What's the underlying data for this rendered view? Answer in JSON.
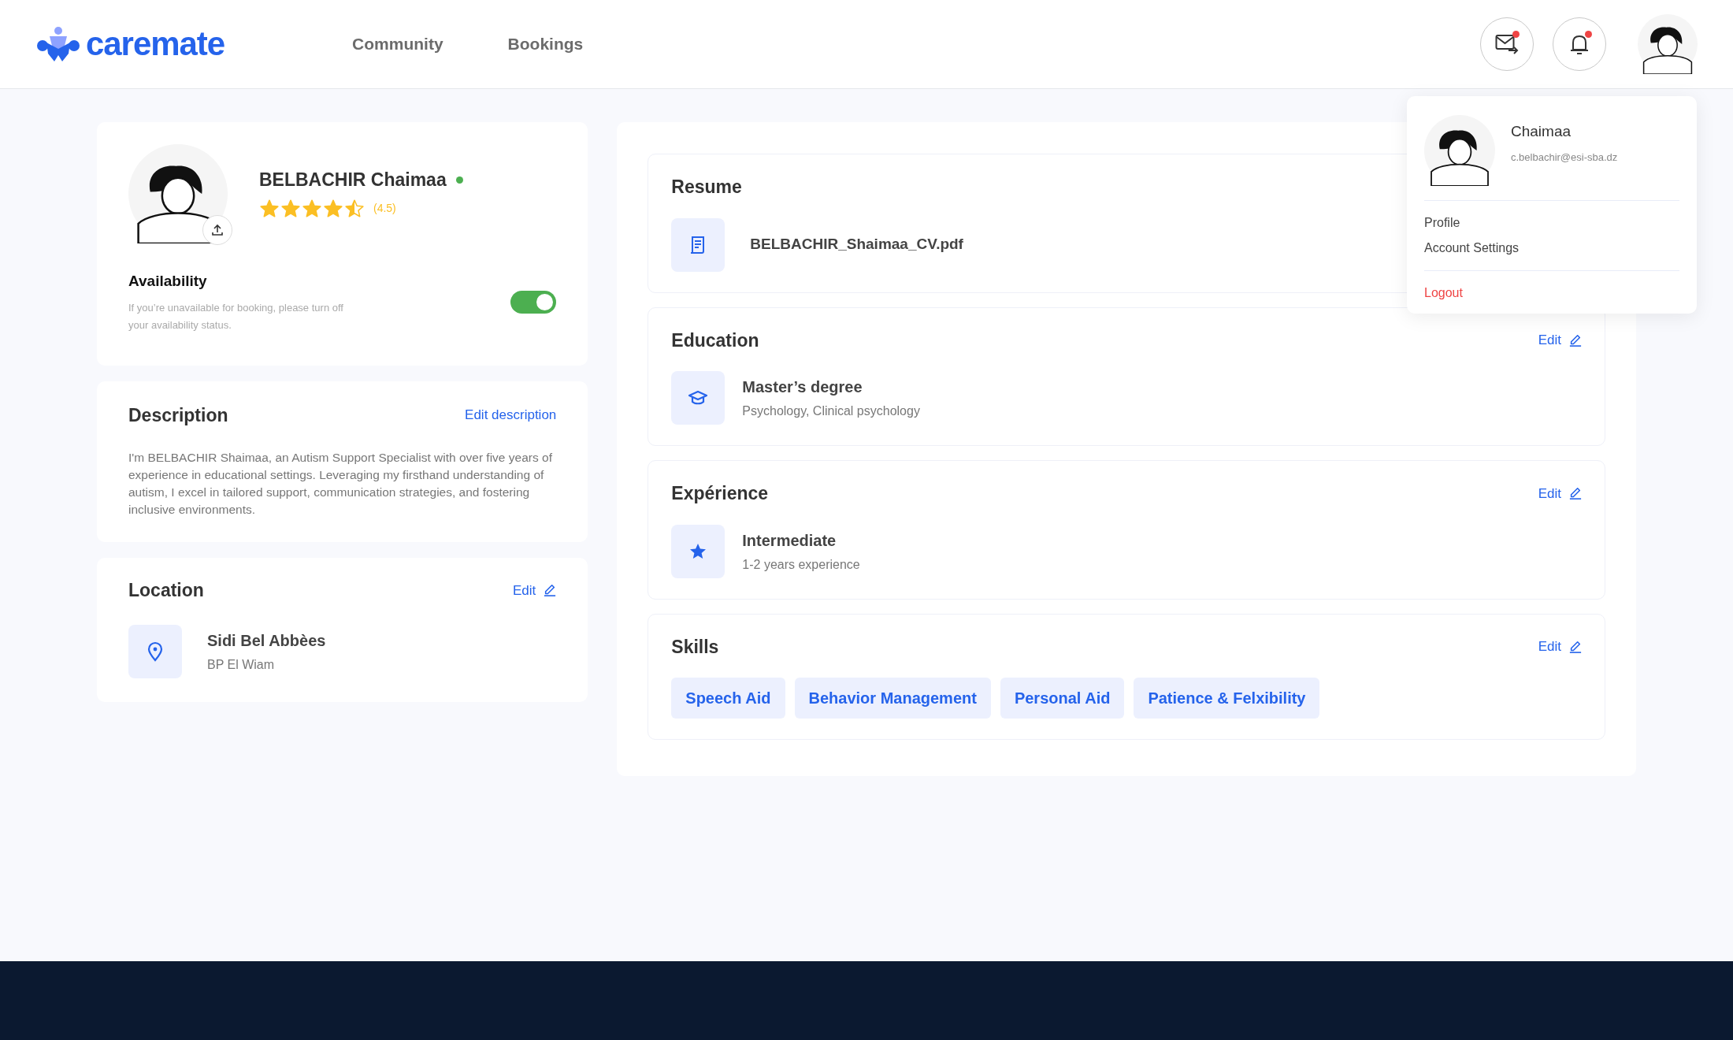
{
  "header": {
    "logo": "caremate",
    "nav": [
      {
        "label": "Community",
        "selected": false
      },
      {
        "label": "Bookings",
        "selected": false
      }
    ],
    "mail_unread": true,
    "bell_unread": true
  },
  "profile": {
    "name": "BELBACHIR Chaimaa",
    "online": true,
    "stars": 4.5,
    "rating": "(4.5)",
    "availability": {
      "title": "Availability",
      "hint": "If you’re unavailable for booking, please turn off your availability status.",
      "on": true
    }
  },
  "description": {
    "title": "Description",
    "action": "Edit description",
    "text": "I'm BELBACHIR Shaimaa, an Autism Support Specialist with over five years of experience in educational settings. Leveraging my firsthand understanding of autism, I excel in tailored support, communication strategies, and fostering inclusive environments."
  },
  "location": {
    "title": "Location",
    "action": "Edit",
    "primary": "Sidi Bel Abbèes",
    "secondary": "BP El Wiam"
  },
  "resume": {
    "title": "Resume",
    "file": "BELBACHIR_Shaimaa_CV.pdf"
  },
  "education": {
    "title": "Education",
    "action": "Edit",
    "primary": "Master’s degree",
    "secondary": "Psychology, Clinical psychology"
  },
  "experience": {
    "title": "Expérience",
    "action": "Edit",
    "primary": "Intermediate",
    "secondary": "1-2 years experience"
  },
  "skills": {
    "title": "Skills",
    "action": "Edit",
    "tags": [
      "Speech Aid",
      "Behavior Management",
      "Personal Aid",
      "Patience & Felxibility"
    ]
  },
  "menu": {
    "name": "Chaimaa",
    "email": "c.belbachir@esi-sba.dz",
    "items": [
      "Profile",
      "Account Settings"
    ],
    "logout": "Logout"
  }
}
